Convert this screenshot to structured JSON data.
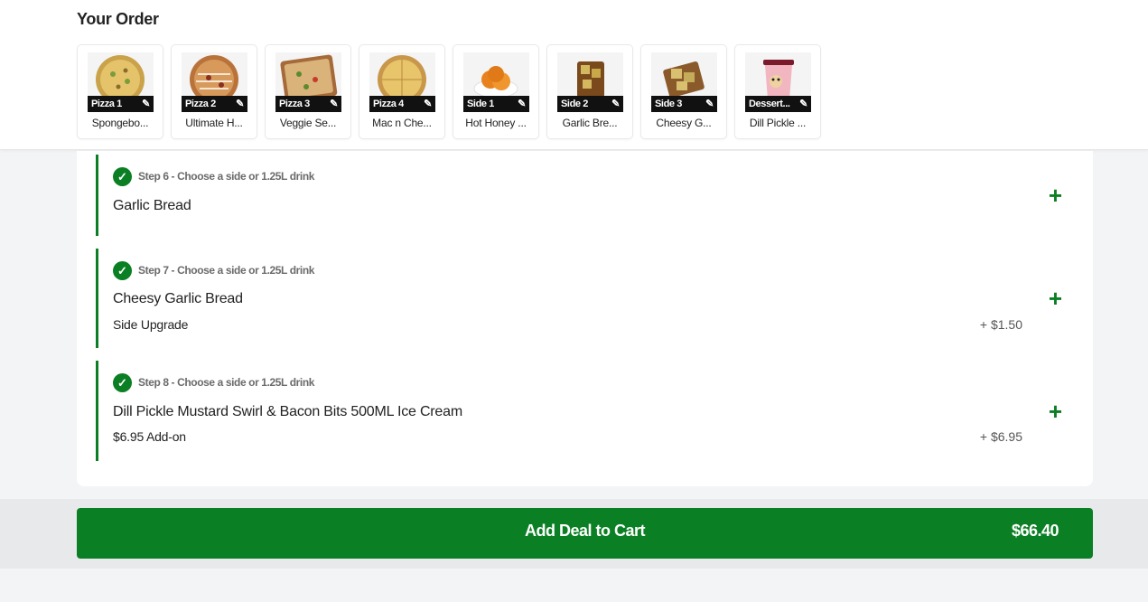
{
  "order": {
    "title": "Your Order",
    "items": [
      {
        "tag": "Pizza 1",
        "name": "Spongebo...",
        "thumb": "pizza-thumbnail"
      },
      {
        "tag": "Pizza 2",
        "name": "Ultimate H...",
        "thumb": "pizza-thumbnail"
      },
      {
        "tag": "Pizza 3",
        "name": "Veggie Se...",
        "thumb": "pizza-thumbnail"
      },
      {
        "tag": "Pizza 4",
        "name": "Mac n Che...",
        "thumb": "pizza-thumbnail"
      },
      {
        "tag": "Side 1",
        "name": "Hot Honey ...",
        "thumb": "side-thumbnail"
      },
      {
        "tag": "Side 2",
        "name": "Garlic Bre...",
        "thumb": "side-thumbnail"
      },
      {
        "tag": "Side 3",
        "name": "Cheesy G...",
        "thumb": "side-thumbnail"
      },
      {
        "tag": "Dessert...",
        "name": "Dill Pickle ...",
        "thumb": "dessert-thumbnail"
      }
    ],
    "edit_icon": "pencil-icon"
  },
  "steps": [
    {
      "label": "Step 6 - Choose a side or 1.25L drink",
      "item": "Garlic Bread",
      "sub": "",
      "price": ""
    },
    {
      "label": "Step 7 - Choose a side or 1.25L drink",
      "item": "Cheesy Garlic Bread",
      "sub": "Side Upgrade",
      "price": "+ $1.50"
    },
    {
      "label": "Step 8 - Choose a side or 1.25L drink",
      "item": "Dill Pickle Mustard Swirl & Bacon Bits 500ML Ice Cream",
      "sub": "$6.95 Add-on",
      "price": "+ $6.95"
    }
  ],
  "icons": {
    "check": "checkmark-circle-icon",
    "plus": "plus-icon"
  },
  "cart": {
    "label": "Add Deal to Cart",
    "total": "$66.40"
  },
  "colors": {
    "accent": "#0b7f23",
    "tag_bg": "#111111"
  }
}
